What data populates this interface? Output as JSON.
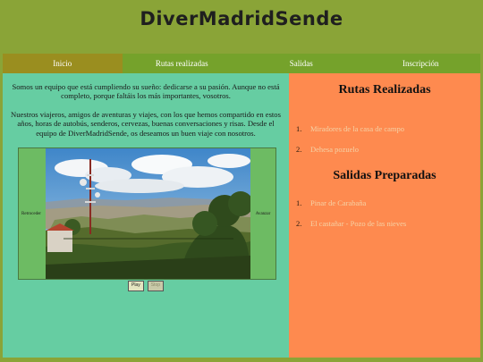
{
  "site": {
    "title": "DiverMadridSende"
  },
  "nav": {
    "items": [
      {
        "label": "Inicio",
        "active": true
      },
      {
        "label": "Rutas realizadas",
        "active": false
      },
      {
        "label": "Salidas",
        "active": false
      },
      {
        "label": "Inscripción",
        "active": false
      }
    ]
  },
  "intro": {
    "paragraph1": "Somos un equipo que está cumpliendo su sueño: dedicarse a su pasión. Aunque no está completo, porque faltáis los más importantes, vosotros.",
    "paragraph2": "Nuestros viajeros, amigos de aventuras y viajes, con los que hemos compartido en estos años, horas de autobús, senderos, cervezas, buenas conversaciones y risas. Desde el equipo de DiverMadridSende, os deseamos un buen viaje con nosotros."
  },
  "carousel": {
    "prev_label": "Retroceder",
    "next_label": "Avanzar",
    "image_icon": "landscape-photo",
    "play_label": "Play",
    "stop_label": "Stop"
  },
  "sidebar": {
    "realizadas_title": "Rutas Realizadas",
    "realizadas": [
      {
        "num": "1.",
        "label": "Miradores de la casa de campo"
      },
      {
        "num": "2.",
        "label": "Dehesa pozuelo"
      }
    ],
    "preparadas_title": "Salidas Preparadas",
    "preparadas": [
      {
        "num": "1.",
        "label": "Pinar de Carabaña"
      },
      {
        "num": "2.",
        "label": "El castañar - Pozo de las nieves"
      }
    ]
  },
  "colors": {
    "background": "#8aa437",
    "nav": "#75a22b",
    "nav_active": "#9a8e1f",
    "left_panel": "#66cda2",
    "right_panel": "#fe8a4f",
    "link": "#f5d2a6"
  }
}
